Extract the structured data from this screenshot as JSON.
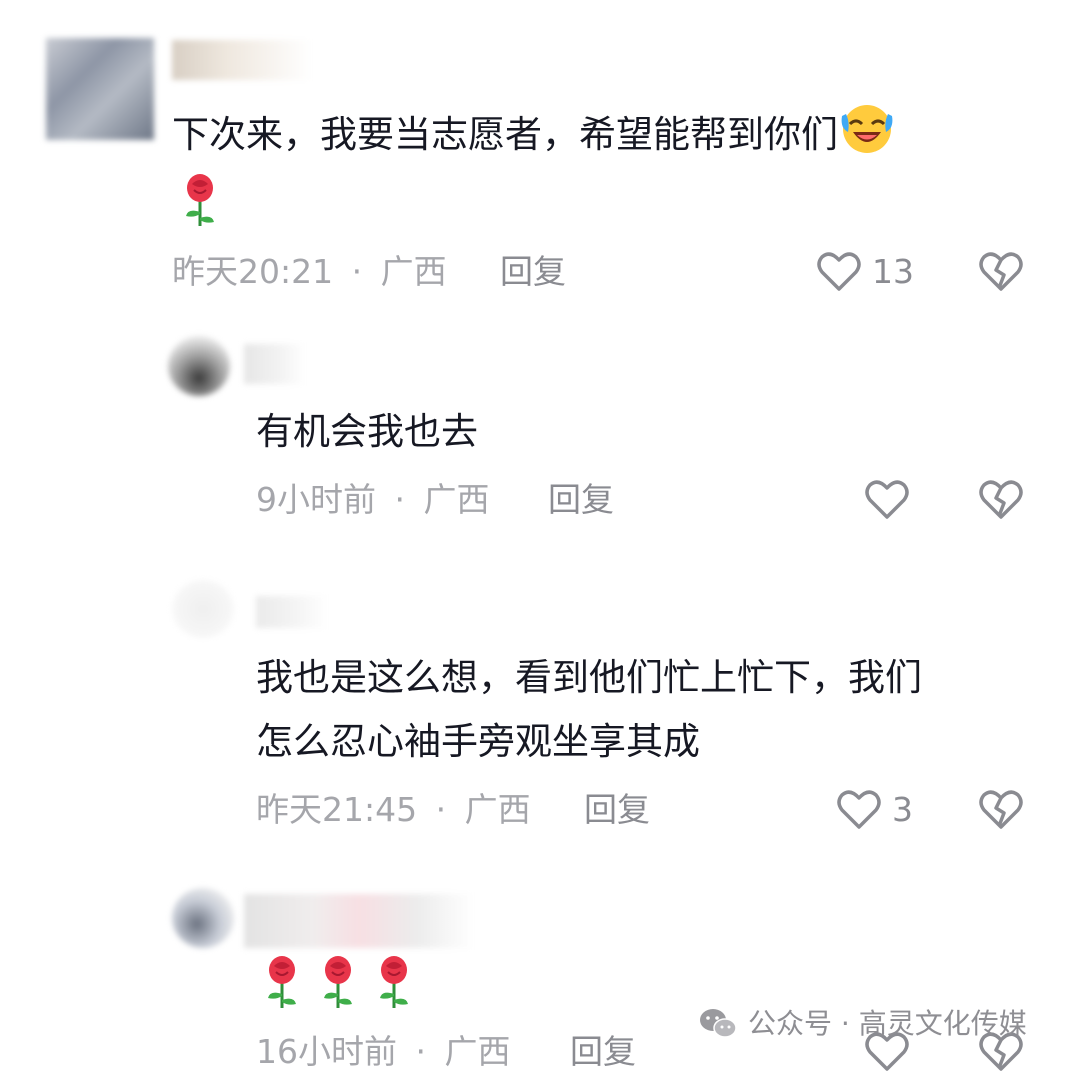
{
  "comments": [
    {
      "text": "下次来，我要当志愿者，希望能帮到你们",
      "time": "昨天20:21",
      "separator": "·",
      "location": "广西",
      "reply_label": "回复",
      "likes": "13"
    },
    {
      "text": "有机会我也去",
      "time": "9小时前",
      "separator": "·",
      "location": "广西",
      "reply_label": "回复",
      "likes": ""
    },
    {
      "text_lines": [
        "我也是这么想，看到他们忙上忙下，我们",
        "怎么忍心袖手旁观坐享其成"
      ],
      "time": "昨天21:45",
      "separator": "·",
      "location": "广西",
      "reply_label": "回复",
      "likes": "3"
    },
    {
      "time": "16小时前",
      "separator": "·",
      "location": "广西",
      "reply_label": "回复",
      "likes": ""
    }
  ],
  "watermark": {
    "label": "公众号 · 高灵文化传媒"
  },
  "icons": {
    "like": "heart-outline-icon",
    "dislike": "broken-heart-icon",
    "emoji_laugh": "laughing-tears-emoji",
    "emoji_rose": "rose-emoji",
    "wechat": "wechat-icon"
  },
  "colors": {
    "text": "#161823",
    "meta": "#a5a6ab",
    "icon": "#8a8b91"
  }
}
